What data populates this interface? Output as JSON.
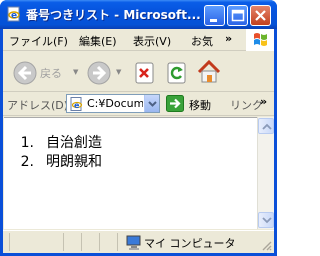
{
  "window": {
    "title": "番号つきリスト - Microsoft...",
    "minimize_label": "minimize",
    "maximize_label": "maximize",
    "close_label": "close"
  },
  "menu": {
    "items": [
      "ファイル(F)",
      "編集(E)",
      "表示(V)",
      "お気"
    ],
    "overflow": "»"
  },
  "toolbar": {
    "back_label": "戻る"
  },
  "address": {
    "label": "アドレス(D)",
    "value": "C:¥Docum",
    "go_label": "移動",
    "links_label": "リンク",
    "links_overflow": "»"
  },
  "content": {
    "list": [
      {
        "number": "1.",
        "text": "自治創造"
      },
      {
        "number": "2.",
        "text": "明朗親和"
      }
    ]
  },
  "status": {
    "zone_label": "マイ コンピュータ"
  },
  "colors": {
    "titlebar": "#0553d8",
    "chrome": "#ece9d8",
    "content_bg": "#ffffff"
  },
  "icons": [
    "ie-page-icon",
    "minimize-icon",
    "maximize-icon",
    "close-icon",
    "windows-flag-icon",
    "back-arrow-icon",
    "forward-arrow-icon",
    "stop-icon",
    "refresh-icon",
    "home-icon",
    "go-arrow-icon",
    "my-computer-icon"
  ]
}
